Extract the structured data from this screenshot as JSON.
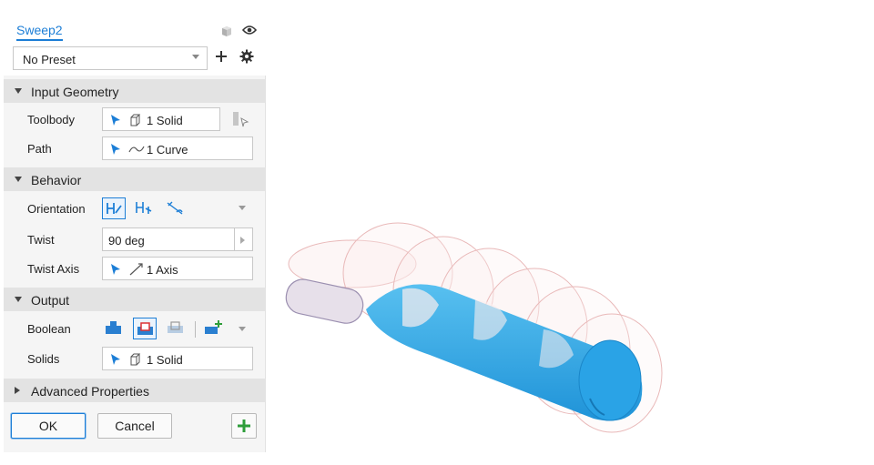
{
  "panel": {
    "title": "Sweep2",
    "preset": "No Preset",
    "sections": {
      "input_geometry": "Input Geometry",
      "behavior": "Behavior",
      "output": "Output",
      "advanced": "Advanced Properties"
    },
    "input_geometry": {
      "toolbody_label": "Toolbody",
      "toolbody_value": "1 Solid",
      "path_label": "Path",
      "path_value": "1 Curve"
    },
    "behavior": {
      "orientation_label": "Orientation",
      "twist_label": "Twist",
      "twist_value": "90 deg",
      "twist_axis_label": "Twist Axis",
      "twist_axis_value": "1 Axis"
    },
    "output": {
      "boolean_label": "Boolean",
      "solids_label": "Solids",
      "solids_value": "1 Solid"
    },
    "buttons": {
      "ok": "OK",
      "cancel": "Cancel"
    }
  },
  "colors": {
    "accent": "#1c7ed6",
    "solid": "#29a3e6",
    "add": "#2e9d3a"
  },
  "icons": [
    "cube-icon",
    "eye-icon",
    "plus-icon",
    "gear-icon",
    "select-arrow-icon",
    "solid-icon",
    "curve-icon",
    "axis-icon"
  ]
}
